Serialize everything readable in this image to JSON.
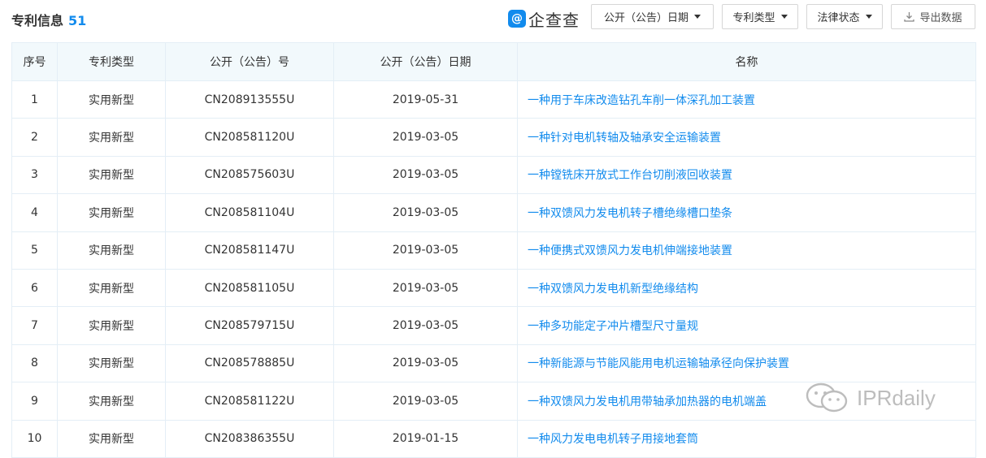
{
  "header": {
    "title": "专利信息",
    "count": "51",
    "logo_text": "企查查",
    "logo_mark": "@",
    "filters": [
      {
        "label": "公开（公告）日期"
      },
      {
        "label": "专利类型"
      },
      {
        "label": "法律状态"
      }
    ],
    "export_label": "导出数据"
  },
  "table": {
    "columns": [
      "序号",
      "专利类型",
      "公开（公告）号",
      "公开（公告）日期",
      "名称"
    ],
    "rows": [
      [
        "1",
        "实用新型",
        "CN208913555U",
        "2019-05-31",
        "一种用于车床改造钻孔车削一体深孔加工装置"
      ],
      [
        "2",
        "实用新型",
        "CN208581120U",
        "2019-03-05",
        "一种针对电机转轴及轴承安全运输装置"
      ],
      [
        "3",
        "实用新型",
        "CN208575603U",
        "2019-03-05",
        "一种镗铣床开放式工作台切削液回收装置"
      ],
      [
        "4",
        "实用新型",
        "CN208581104U",
        "2019-03-05",
        "一种双馈风力发电机转子槽绝缘槽口垫条"
      ],
      [
        "5",
        "实用新型",
        "CN208581147U",
        "2019-03-05",
        "一种便携式双馈风力发电机伸端接地装置"
      ],
      [
        "6",
        "实用新型",
        "CN208581105U",
        "2019-03-05",
        "一种双馈风力发电机新型绝缘结构"
      ],
      [
        "7",
        "实用新型",
        "CN208579715U",
        "2019-03-05",
        "一种多功能定子冲片槽型尺寸量规"
      ],
      [
        "8",
        "实用新型",
        "CN208578885U",
        "2019-03-05",
        "一种新能源与节能风能用电机运输轴承径向保护装置"
      ],
      [
        "9",
        "实用新型",
        "CN208581122U",
        "2019-03-05",
        "一种双馈风力发电机用带轴承加热器的电机端盖"
      ],
      [
        "10",
        "实用新型",
        "CN208386355U",
        "2019-01-15",
        "一种风力发电电机转子用接地套筒"
      ]
    ]
  },
  "watermark": {
    "text": "IPRdaily",
    "icon": "wechat-icon"
  },
  "colors": {
    "accent": "#128bed",
    "header_bg": "#f2f9fc",
    "border": "#e4eef6"
  }
}
